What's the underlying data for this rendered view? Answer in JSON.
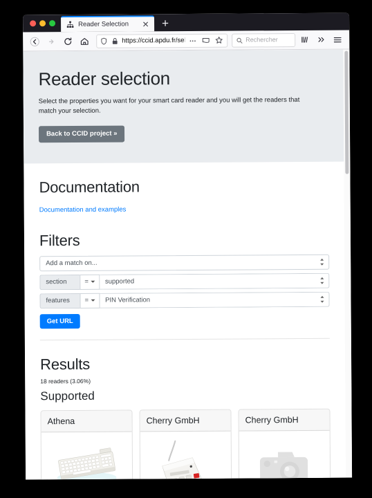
{
  "browser": {
    "tab": {
      "title": "Reader Selection",
      "favicon_icon": "sitemap-icon",
      "close_icon": "close-icon"
    },
    "new_tab_icon": "plus-icon",
    "nav": {
      "back_icon": "arrow-left-icon",
      "forward_icon": "arrow-right-icon",
      "reload_icon": "reload-icon",
      "home_icon": "home-icon"
    },
    "url": {
      "shield_icon": "shield-icon",
      "lock_icon": "lock-icon",
      "value": "https://ccid.apdu.fr/select_readers/",
      "value_faded": "?s",
      "more_icon": "ellipsis-icon",
      "reader_icon": "reader-view-icon",
      "bookmark_icon": "star-icon"
    },
    "search": {
      "icon": "search-icon",
      "placeholder": "Rechercher"
    },
    "toolbar": {
      "library_icon": "library-icon",
      "overflow_icon": "chevron-double-right-icon",
      "menu_icon": "hamburger-menu-icon"
    },
    "window_controls": {
      "close": "close-dot",
      "minimize": "minimize-dot",
      "maximize": "maximize-dot"
    }
  },
  "hero": {
    "title": "Reader selection",
    "description": "Select the properties you want for your smart card reader and you will get the readers that match your selection.",
    "button_label": "Back to CCID project »"
  },
  "documentation": {
    "heading": "Documentation",
    "link_label": "Documentation and examples"
  },
  "filters": {
    "heading": "Filters",
    "add_match": {
      "label": "Add a match on...",
      "placeholder": "Add a match on..."
    },
    "rows": [
      {
        "field": "section",
        "operator": "=",
        "value": "supported"
      },
      {
        "field": "features",
        "operator": "=",
        "value": "PIN Verification"
      }
    ],
    "get_url_label": "Get URL"
  },
  "results": {
    "heading": "Results",
    "count_text": "18 readers (3.06%)",
    "subheading": "Supported",
    "cards": [
      {
        "vendor": "Athena",
        "image_icon": "keyboard-reader-image"
      },
      {
        "vendor": "Cherry GmbH",
        "image_icon": "pinpad-reader-image"
      },
      {
        "vendor": "Cherry GmbH",
        "image_icon": "broken-image-placeholder-icon"
      }
    ]
  },
  "colors": {
    "primary": "#007bff",
    "secondary": "#6c757d",
    "hero_bg": "#e9ecef",
    "link": "#007bff"
  }
}
